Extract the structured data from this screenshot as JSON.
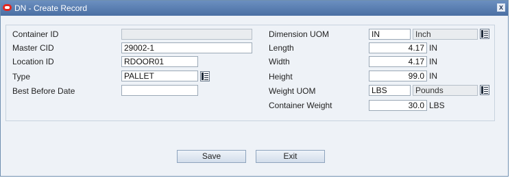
{
  "window": {
    "title": "DN - Create Record",
    "close_label": "x"
  },
  "left_fields": {
    "container_id": {
      "label": "Container ID",
      "value": ""
    },
    "master_cid": {
      "label": "Master CID",
      "value": "29002-1"
    },
    "location_id": {
      "label": "Location ID",
      "value": "RDOOR01"
    },
    "type": {
      "label": "Type",
      "value": "PALLET"
    },
    "best_before_date": {
      "label": "Best Before Date",
      "value": ""
    }
  },
  "right_fields": {
    "dimension_uom": {
      "label": "Dimension UOM",
      "code": "IN",
      "description": "Inch"
    },
    "length": {
      "label": "Length",
      "value": "4.17",
      "unit": "IN"
    },
    "width": {
      "label": "Width",
      "value": "4.17",
      "unit": "IN"
    },
    "height": {
      "label": "Height",
      "value": "99.0",
      "unit": "IN"
    },
    "weight_uom": {
      "label": "Weight UOM",
      "code": "LBS",
      "description": "Pounds"
    },
    "container_weight": {
      "label": "Container Weight",
      "value": "30.0",
      "unit": "LBS"
    }
  },
  "buttons": {
    "save": "Save",
    "exit": "Exit"
  },
  "colors": {
    "title_bar": "#4a6fa3",
    "panel_bg": "#eef2f7",
    "oracle_red": "#e3261f"
  }
}
